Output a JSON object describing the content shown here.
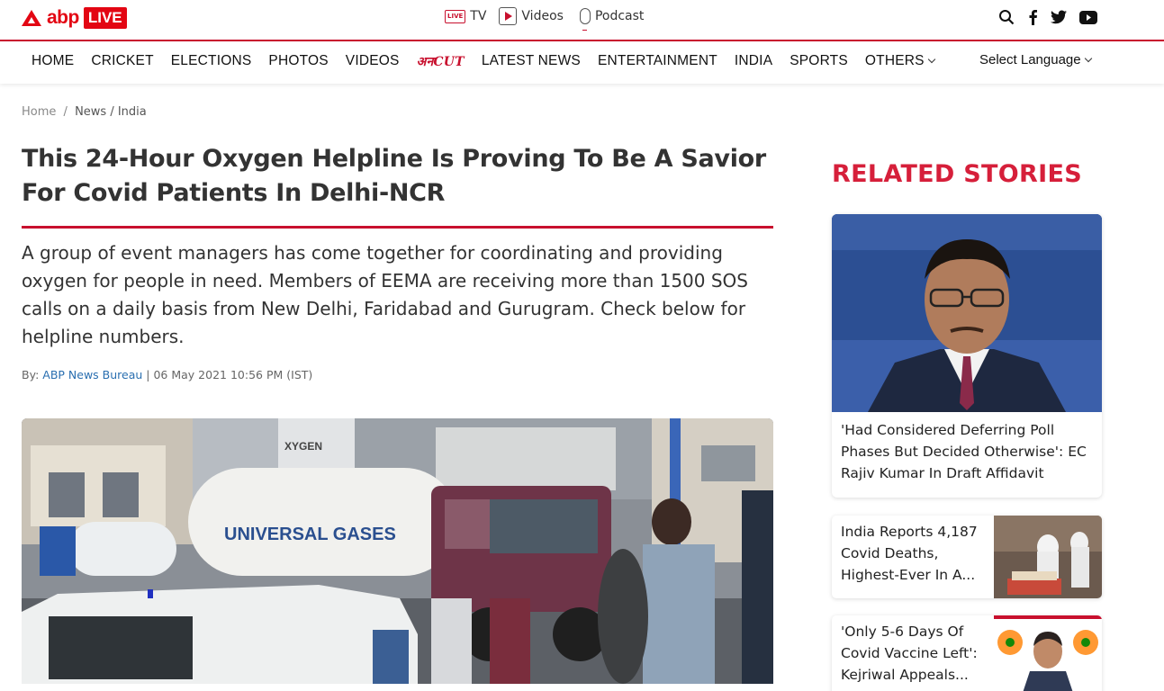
{
  "header": {
    "logo_text": "abp",
    "logo_live": "LIVE",
    "top_links": [
      {
        "label": "TV",
        "icon": "live-tv-icon"
      },
      {
        "label": "Videos",
        "icon": "play-icon"
      },
      {
        "label": "Podcast",
        "icon": "microphone-icon"
      }
    ],
    "social_icons": [
      "search-icon",
      "facebook-icon",
      "twitter-icon",
      "youtube-icon"
    ],
    "accent_color": "#c8102e"
  },
  "nav": {
    "items": [
      "HOME",
      "CRICKET",
      "ELECTIONS",
      "PHOTOS",
      "VIDEOS"
    ],
    "anncut_logo": "अनCUT",
    "items_after": [
      "LATEST NEWS",
      "ENTERTAINMENT",
      "INDIA",
      "SPORTS"
    ],
    "others": "OTHERS",
    "language": "Select Language"
  },
  "breadcrumb": {
    "home": "Home",
    "sep": "/",
    "current": "News / India"
  },
  "article": {
    "title": "This 24-Hour Oxygen Helpline Is Proving To Be A Savior For Covid Patients In Delhi-NCR",
    "summary": "A group of event managers has come together for coordinating and providing oxygen for people in need. Members of EEMA are receiving more than 1500 SOS calls on a daily basis from New Delhi, Faridabad and Gurugram. Check below for helpline numbers.",
    "by_label": "By:",
    "author": "ABP News Bureau",
    "separator": "|",
    "date": "06 May 2021 10:56 PM (IST)",
    "hero_tanker_text": "UNIVERSAL GASES",
    "hero_sign_text": "XYGEN"
  },
  "sidebar": {
    "heading": "RELATED STORIES",
    "stories": [
      {
        "title": "'Had Considered Deferring Poll Phases But Decided Otherwise': EC Rajiv Kumar In Draft Affidavit"
      },
      {
        "title": "India Reports 4,187 Covid Deaths, Highest-Ever In A..."
      },
      {
        "title": "'Only 5-6 Days Of Covid Vaccine Left': Kejriwal Appeals..."
      }
    ]
  }
}
